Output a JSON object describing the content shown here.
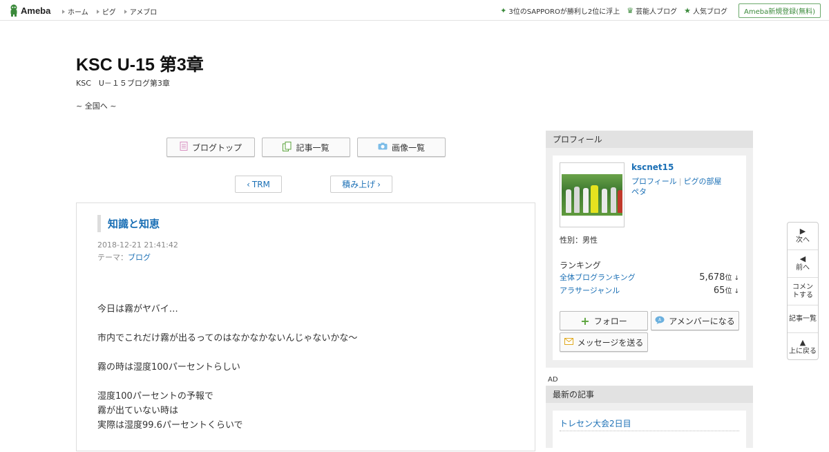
{
  "topbar": {
    "logo_text": "Ameba",
    "nav": [
      "ホーム",
      "ピグ",
      "アメブロ"
    ],
    "news": "3位のSAPPOROが勝利し2位に浮上",
    "celeb_blog": "芸能人ブログ",
    "popular_blog": "人気ブログ",
    "signup": "Ameba新規登録(無料)"
  },
  "header": {
    "title": "KSC U-15 第3章",
    "subtitle": "KSC　U－１５ブログ第3章",
    "description": "~ 全国へ ~"
  },
  "nav_buttons": {
    "blog_top": "ブログトップ",
    "article_list": "記事一覧",
    "image_list": "画像一覧"
  },
  "pager": {
    "prev": "TRM",
    "next": "積み上げ"
  },
  "article": {
    "title": "知識と知恵",
    "date": "2018-12-21 21:41:42",
    "theme_label": "テーマ：",
    "theme": "ブログ",
    "body": [
      "今日は霧がヤバイ…",
      "市内でこれだけ霧が出るってのはなかなかないんじゃないかな〜",
      "霧の時は湿度100パーセントらしい",
      "湿度100パーセントの予報で",
      "霧が出ていない時は",
      "実際は湿度99.6パーセントくらいで"
    ]
  },
  "profile": {
    "heading": "プロフィール",
    "name": "kscnet15",
    "link_profile": "プロフィール",
    "link_pig": "ピグの部屋",
    "link_peta": "ペタ",
    "gender": "性別：男性",
    "ranking_label": "ランキング",
    "rankings": [
      {
        "label": "全体ブログランキング",
        "value": "5,678",
        "unit": "位",
        "arrow": "↓"
      },
      {
        "label": "アラサージャンル",
        "value": "65",
        "unit": "位",
        "arrow": "↓"
      }
    ],
    "follow": "フォロー",
    "amember": "アメンバーになる",
    "message": "メッセージを送る"
  },
  "ad_label": "AD",
  "latest": {
    "heading": "最新の記事",
    "items": [
      "トレセン大会2日目"
    ]
  },
  "floatnav": {
    "next": "次へ",
    "prev": "前へ",
    "comment": "コメントする",
    "list": "記事一覧",
    "top": "上に戻る"
  },
  "colors": {
    "link": "#1a6fb5",
    "ameba_green": "#3b8a3b",
    "sidebar_bg": "#efefef"
  }
}
